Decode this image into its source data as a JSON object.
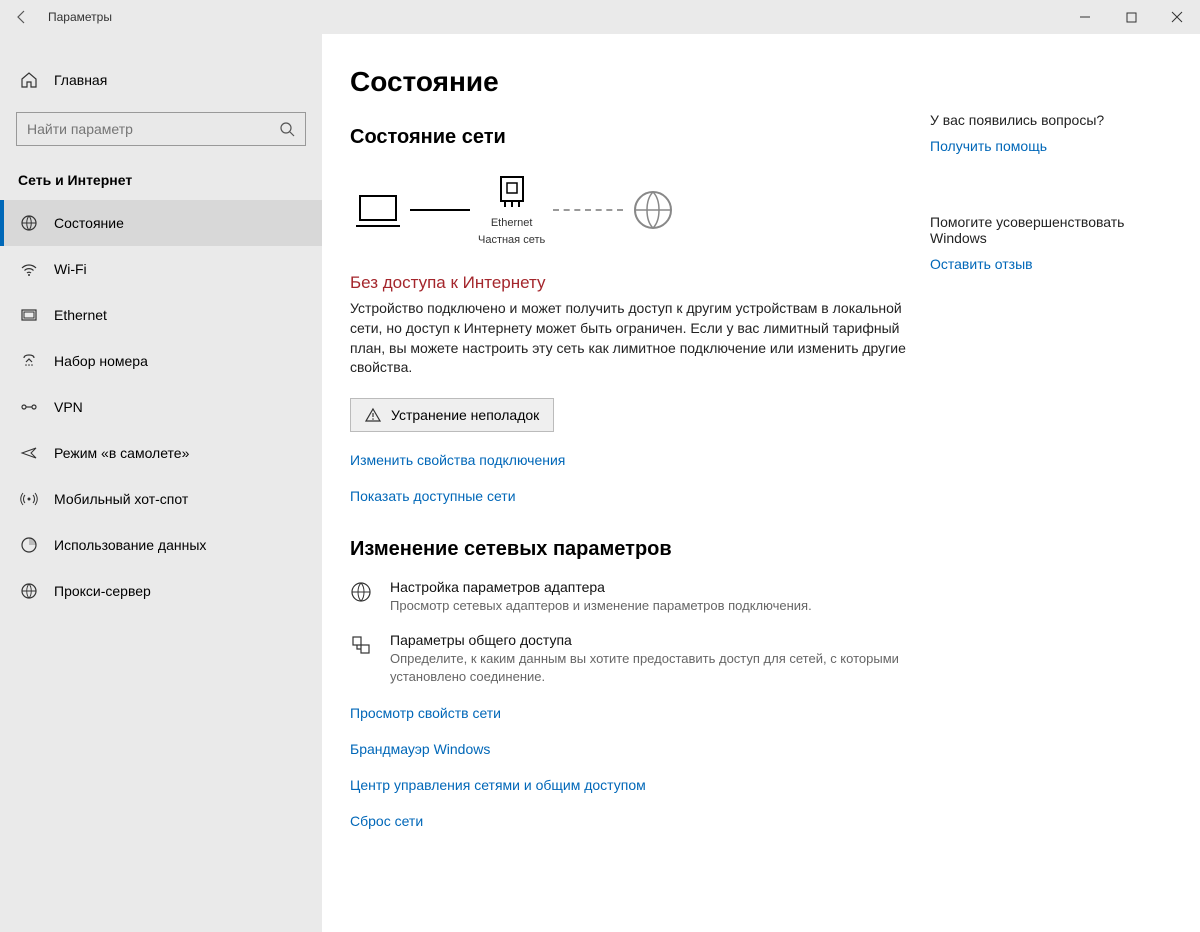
{
  "window": {
    "title": "Параметры"
  },
  "sidebar": {
    "home": "Главная",
    "search_placeholder": "Найти параметр",
    "group": "Сеть и Интернет",
    "items": [
      {
        "label": "Состояние"
      },
      {
        "label": "Wi-Fi"
      },
      {
        "label": "Ethernet"
      },
      {
        "label": "Набор номера"
      },
      {
        "label": "VPN"
      },
      {
        "label": "Режим «в самолете»"
      },
      {
        "label": "Мобильный хот-спот"
      },
      {
        "label": "Использование данных"
      },
      {
        "label": "Прокси-сервер"
      }
    ]
  },
  "main": {
    "title": "Состояние",
    "section_status": "Состояние сети",
    "diagram": {
      "conn_name": "Ethernet",
      "conn_type": "Частная сеть"
    },
    "error_title": "Без доступа к Интернету",
    "error_body": "Устройство подключено и может получить доступ к другим устройствам в локальной сети, но доступ к Интернету может быть ограничен. Если у вас лимитный тарифный план, вы можете настроить эту сеть как лимитное подключение или изменить другие свойства.",
    "troubleshoot": "Устранение неполадок",
    "link_change_props": "Изменить свойства подключения",
    "link_show_networks": "Показать доступные сети",
    "section_change": "Изменение сетевых параметров",
    "opt_adapter_title": "Настройка параметров адаптера",
    "opt_adapter_desc": "Просмотр сетевых адаптеров и изменение параметров подключения.",
    "opt_sharing_title": "Параметры общего доступа",
    "opt_sharing_desc": "Определите, к каким данным вы хотите предоставить доступ для сетей, с которыми установлено соединение.",
    "link_view_props": "Просмотр свойств сети",
    "link_firewall": "Брандмауэр Windows",
    "link_sharing_center": "Центр управления сетями и общим доступом",
    "link_reset": "Сброс сети"
  },
  "right": {
    "q_title": "У вас появились вопросы?",
    "q_link": "Получить помощь",
    "fb_title": "Помогите усовершенствовать Windows",
    "fb_link": "Оставить отзыв"
  }
}
